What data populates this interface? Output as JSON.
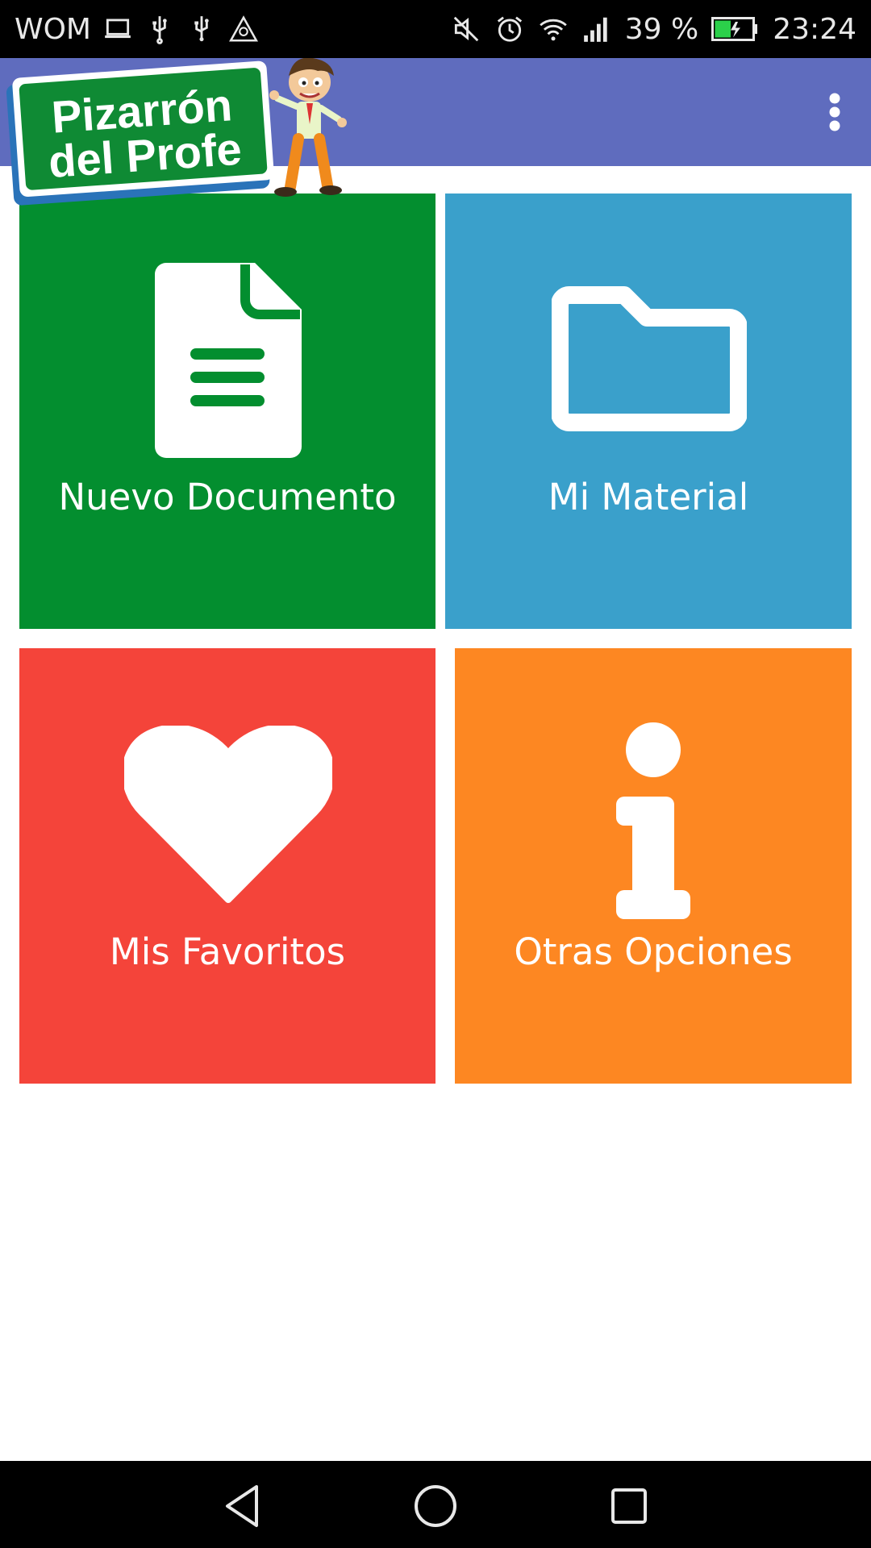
{
  "status_bar": {
    "carrier": "WOM",
    "battery_percent": "39 %",
    "time": "23:24",
    "icons_left": [
      "laptop-icon",
      "usb-icon",
      "usb-icon",
      "warning-icon"
    ],
    "icons_right": [
      "mute-icon",
      "alarm-icon",
      "wifi-icon",
      "signal-icon",
      "battery-icon"
    ]
  },
  "app_bar": {
    "logo_text_line1": "Pizarrón",
    "logo_text_line2": "del Profe",
    "menu_icon": "more-vertical-icon"
  },
  "tiles": [
    {
      "label": "Nuevo Documento",
      "icon": "document-icon",
      "color": "#038e2f"
    },
    {
      "label": "Mi Material",
      "icon": "folder-icon",
      "color": "#3aa0cb"
    },
    {
      "label": "Mis Favoritos",
      "icon": "heart-icon",
      "color": "#f4443a"
    },
    {
      "label": "Otras Opciones",
      "icon": "info-icon",
      "color": "#fd8722"
    }
  ],
  "nav_bar": {
    "buttons": [
      "back-icon",
      "home-icon",
      "recents-icon"
    ]
  },
  "colors": {
    "app_bar": "#5f6cbe",
    "status_bar": "#000000",
    "nav_bar": "#000000"
  }
}
